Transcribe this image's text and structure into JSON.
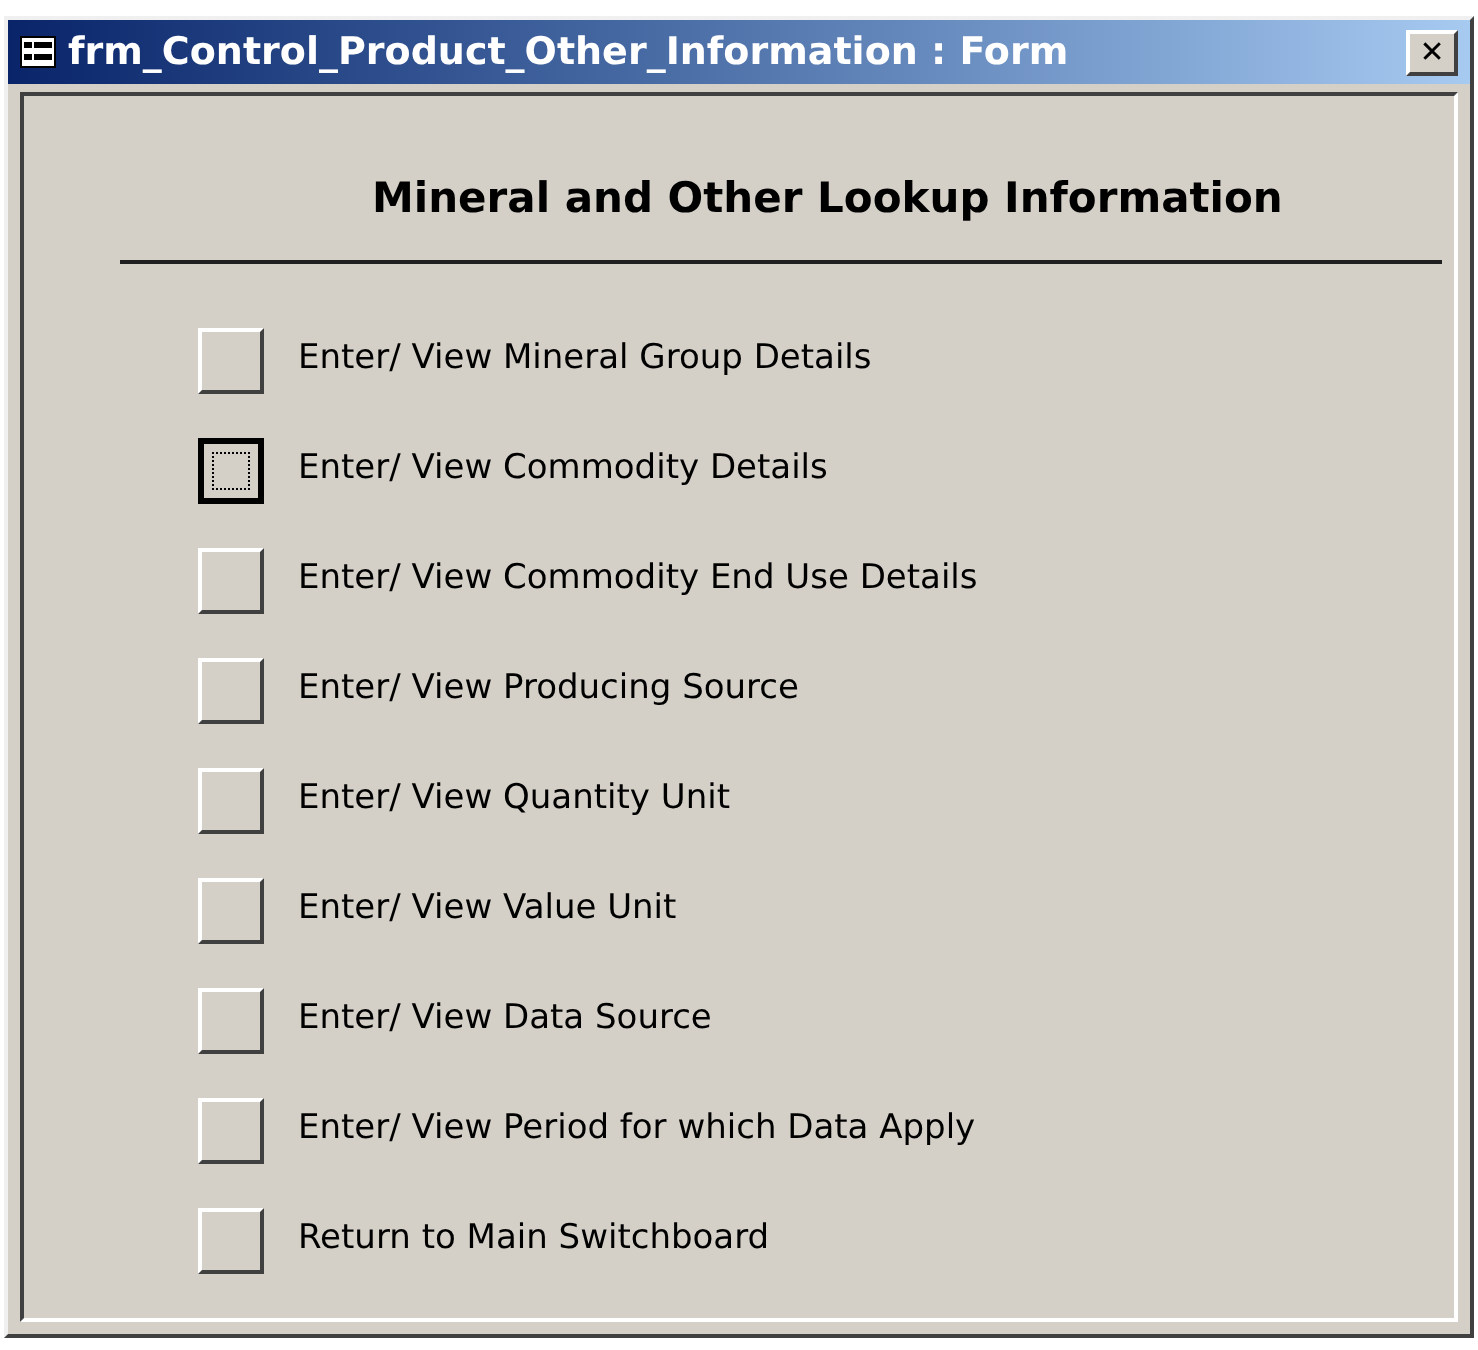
{
  "window": {
    "title": "frm_Control_Product_Other_Information : Form",
    "close_label": "✕"
  },
  "heading": "Mineral and Other Lookup Information",
  "items": [
    {
      "label": "Enter/ View Mineral Group Details",
      "focused": false
    },
    {
      "label": "Enter/ View Commodity Details",
      "focused": true
    },
    {
      "label": "Enter/ View Commodity End Use Details",
      "focused": false
    },
    {
      "label": "Enter/ View Producing Source",
      "focused": false
    },
    {
      "label": "Enter/ View Quantity Unit",
      "focused": false
    },
    {
      "label": "Enter/ View Value Unit",
      "focused": false
    },
    {
      "label": "Enter/ View Data Source",
      "focused": false
    },
    {
      "label": "Enter/ View Period for which Data Apply",
      "focused": false
    },
    {
      "label": "Return to Main Switchboard",
      "focused": false
    }
  ]
}
